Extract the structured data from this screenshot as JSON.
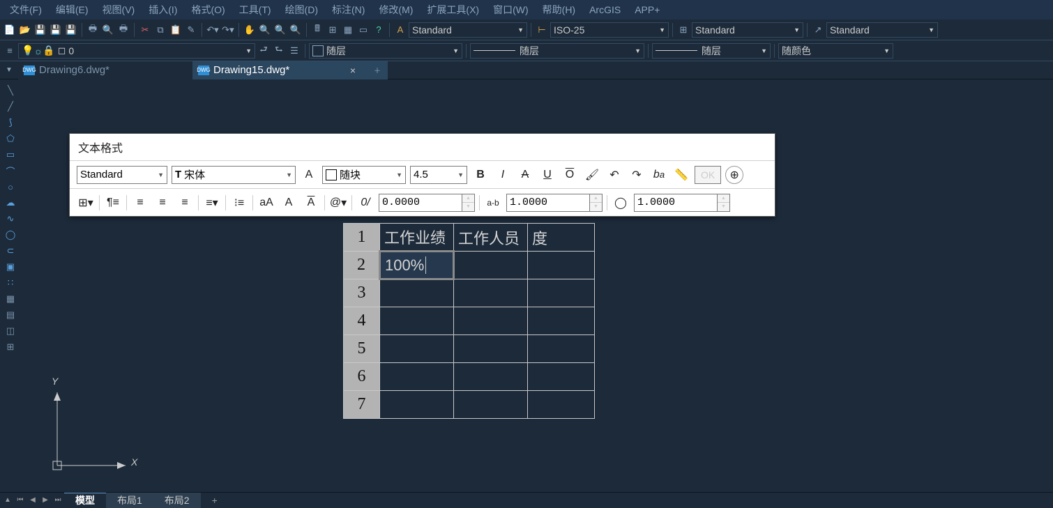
{
  "menu": {
    "file": "文件(F)",
    "edit": "编辑(E)",
    "view": "视图(V)",
    "insert": "插入(I)",
    "format": "格式(O)",
    "tools": "工具(T)",
    "draw": "绘图(D)",
    "dimension": "标注(N)",
    "modify": "修改(M)",
    "extension": "扩展工具(X)",
    "window": "窗口(W)",
    "help": "帮助(H)",
    "arcgis": "ArcGIS",
    "appplus": "APP+"
  },
  "topcombo": {
    "style": "Standard",
    "dim": "ISO-25",
    "std3": "Standard",
    "std4": "Standard"
  },
  "layerrow": {
    "layer0": "0",
    "bylayer": "随层",
    "bycolor": "随颜色"
  },
  "tabs": {
    "inactive": "Drawing6.dwg*",
    "active": "Drawing15.dwg*"
  },
  "ucs": {
    "x": "X",
    "y": "Y"
  },
  "textfmt": {
    "title": "文本格式",
    "style": "Standard",
    "font": "宋体",
    "color": "随块",
    "height": "4.5",
    "B": "B",
    "I": "I",
    "S": "A",
    "U": "U",
    "O": "O",
    "OK": "OK",
    "at": "@",
    "slash": "0/",
    "ab": "a-b",
    "track": "0.0000",
    "width": "1.0000",
    "oblique": "1.0000",
    "small_a": "a",
    "arrowA": "A",
    "vectA": "A",
    "italic_b": "b"
  },
  "table": {
    "header": {
      "c2": "工作业绩",
      "c3": "工作人员",
      "c4": "度"
    },
    "rows": [
      "1",
      "2",
      "3",
      "4",
      "5",
      "6",
      "7"
    ],
    "editing": "100%"
  },
  "layouts": {
    "model": "模型",
    "l1": "布局1",
    "l2": "布局2"
  }
}
